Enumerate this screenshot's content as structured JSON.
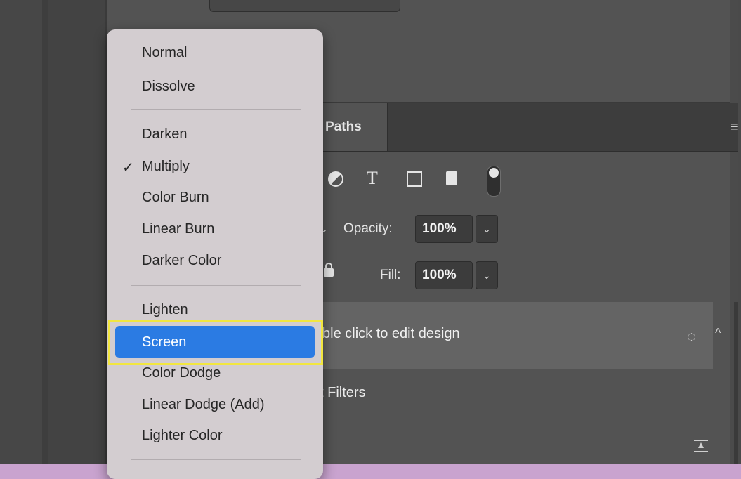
{
  "layers_panel": {
    "tab_paths": "Paths",
    "opacity_label": "Opacity:",
    "opacity_value": "100%",
    "fill_label": "Fill:",
    "fill_value": "100%",
    "layer_text": "ble click to edit design",
    "filters_text": "t Filters",
    "menu_icon": "≡"
  },
  "blend_menu": {
    "items": {
      "normal": "Normal",
      "dissolve": "Dissolve",
      "darken": "Darken",
      "multiply": "Multiply",
      "color_burn": "Color Burn",
      "linear_burn": "Linear Burn",
      "darker_color": "Darker Color",
      "lighten": "Lighten",
      "screen": "Screen",
      "color_dodge": "Color Dodge",
      "linear_dodge": "Linear Dodge (Add)",
      "lighter_color": "Lighter Color"
    },
    "checked": "Multiply",
    "highlighted": "Screen",
    "check_mark": "✓"
  },
  "colors": {
    "highlight_blue": "#2b7be3",
    "callout_yellow": "#f2e640",
    "menu_bg": "#d3cdd0"
  },
  "icons": {
    "toolbar": [
      "adjustment-circle-icon",
      "type-icon",
      "transform-icon",
      "smart-object-icon",
      "filter-toggle-icon"
    ],
    "layer_row": [
      "smart-filter-icon",
      "caret-up-icon"
    ]
  }
}
